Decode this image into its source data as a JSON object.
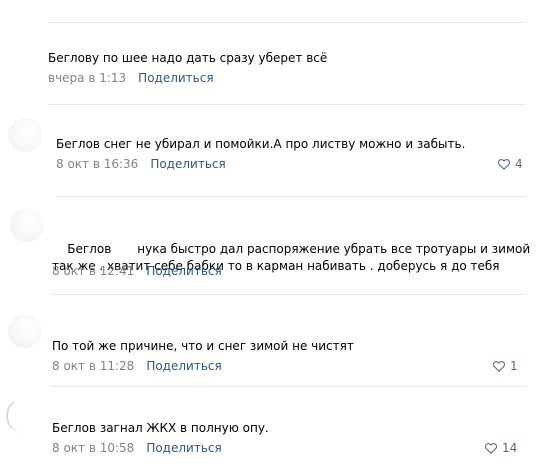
{
  "comments": [
    {
      "text": "Беглову по шее надо дать сразу уберет всё",
      "date": "вчера в 1:13",
      "share_label": "Поделиться",
      "likes": ""
    },
    {
      "text": "Беглов снег не убирал и помойки.А про листву можно и забыть.",
      "date": "8 окт в 16:36",
      "share_label": "Поделиться",
      "likes": "4"
    },
    {
      "text_part1": "Беглов",
      "text_part2": "нука быстро дал распоряжение убрать все тротуары и зимой",
      "text_line2": "так же . хватит себе бабки то в карман набивать . доберусь я до тебя",
      "date": "8 окт в 12:41",
      "share_label": "Поделиться",
      "likes": ""
    },
    {
      "text": "По той же причине, что и снег зимой не чистят",
      "date": "8 окт в 11:28",
      "share_label": "Поделиться",
      "likes": "1"
    },
    {
      "text": "Беглов загнал ЖКХ в полную опу.",
      "date": "8 окт в 10:58",
      "share_label": "Поделиться",
      "likes": "14"
    }
  ],
  "colors": {
    "link": "#2a5885",
    "meta": "#828282",
    "like_icon": "#546a84",
    "divider": "#e7e8ec"
  },
  "icons": {
    "like": "heart-icon"
  }
}
